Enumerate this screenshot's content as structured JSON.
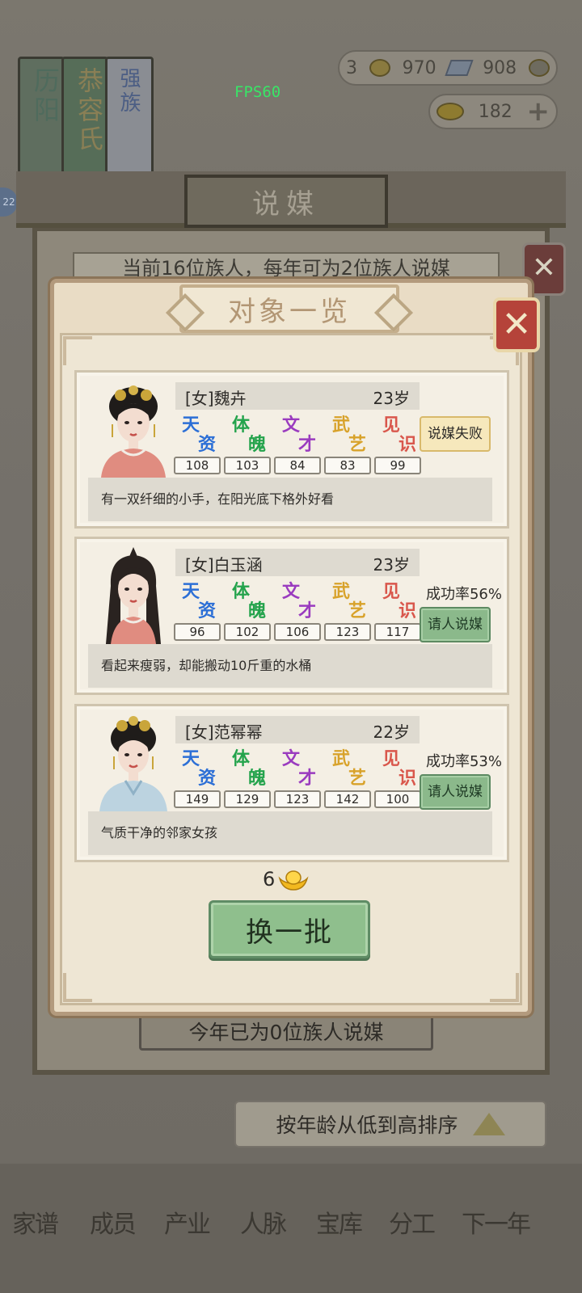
{
  "fps": "FPS60",
  "top_bar": {
    "banners": [
      "历阳",
      "恭容氏",
      "强族"
    ],
    "left_badge": "22",
    "resources": [
      {
        "icon": "copper-coin-icon",
        "value": "3"
      },
      {
        "icon": "silver-ingot-icon",
        "value": "970"
      },
      {
        "icon": "gem-icon",
        "value": "908"
      }
    ],
    "gold": {
      "icon": "gold-ingot-icon",
      "value": "182"
    }
  },
  "outer_dialog": {
    "title": "说媒",
    "info": "当前16位族人，每年可为2位族人说媒",
    "count_text": "今年已为0位族人说媒",
    "sort_label": "按年龄从低到高排序"
  },
  "dialog": {
    "title": "对象一览",
    "stat_labels": [
      {
        "a": "天",
        "b": "资",
        "color": "#2c6fd6"
      },
      {
        "a": "体",
        "b": "魄",
        "color": "#24a34c"
      },
      {
        "a": "文",
        "b": "才",
        "color": "#9a3bbf"
      },
      {
        "a": "武",
        "b": "艺",
        "color": "#d8a22a"
      },
      {
        "a": "见",
        "b": "识",
        "color": "#d9574c"
      }
    ],
    "candidates": [
      {
        "name": "[女]魏卉",
        "age": "23岁",
        "stats": [
          "108",
          "103",
          "84",
          "83",
          "99"
        ],
        "rate": "",
        "button": "说媒失败",
        "desc": "有一双纤细的小手，在阳光底下格外好看"
      },
      {
        "name": "[女]白玉涵",
        "age": "23岁",
        "stats": [
          "96",
          "102",
          "106",
          "123",
          "117"
        ],
        "rate": "成功率56%",
        "button": "请人说媒",
        "desc": "看起来瘦弱，却能搬动10斤重的水桶"
      },
      {
        "name": "[女]范幂幂",
        "age": "22岁",
        "stats": [
          "149",
          "129",
          "123",
          "142",
          "100"
        ],
        "rate": "成功率53%",
        "button": "请人说媒",
        "desc": "气质干净的邻家女孩"
      }
    ],
    "refresh_cost": "6",
    "refresh_label": "换一批"
  },
  "bottom_nav": [
    "家谱",
    "成员",
    "产业",
    "人脉",
    "宝库",
    "分工",
    "下一年"
  ],
  "colors": {
    "accent_green": "#8fbf8d",
    "close_red": "#b5433a",
    "panel_bg": "#e9dcc5"
  }
}
